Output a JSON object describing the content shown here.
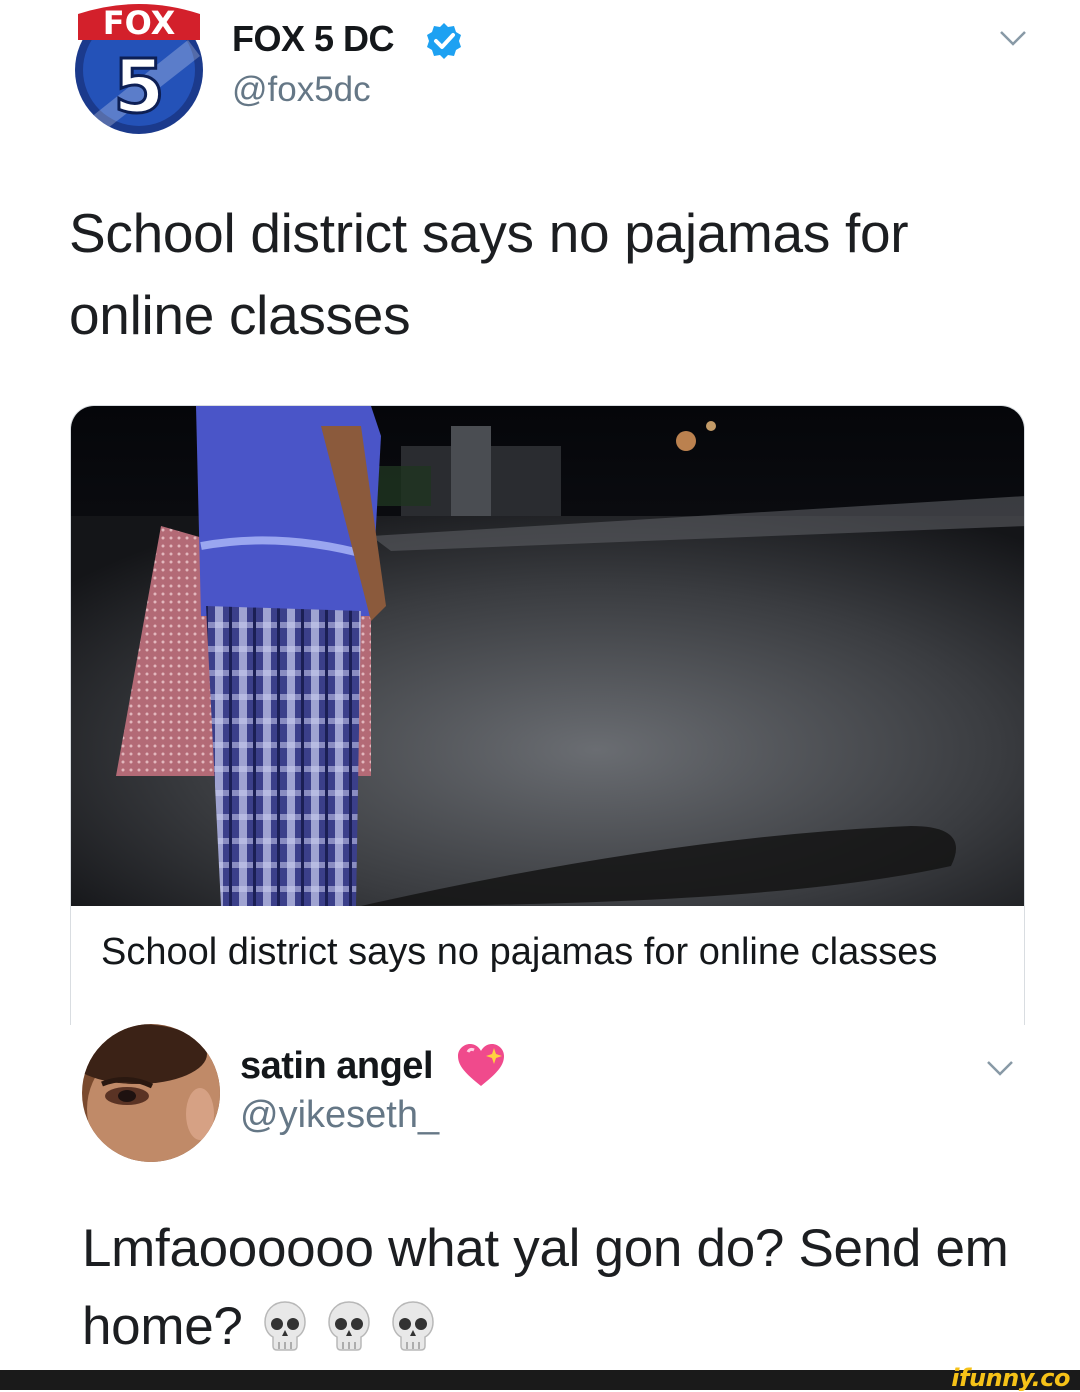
{
  "tweet1": {
    "logo_text_top": "FOX",
    "logo_text_num": "5",
    "name": "FOX 5 DC",
    "handle": "@fox5dc",
    "text": "School district says no pajamas for online classes",
    "card": {
      "title": "School district says no pajamas for online classes"
    }
  },
  "tweet2": {
    "name": "satin angel",
    "handle": "@yikeseth_",
    "text": "Lmfaoooooo what yal gon do? Send em home?"
  },
  "watermark": "ifunny.co",
  "icons": [
    "fox5-logo",
    "verified-badge-icon",
    "chevron-down-icon",
    "sparkling-heart-icon",
    "skull-icon"
  ],
  "colors": {
    "verified": "#1da1f2",
    "handle": "#657786",
    "watermark": "#f6c218"
  }
}
